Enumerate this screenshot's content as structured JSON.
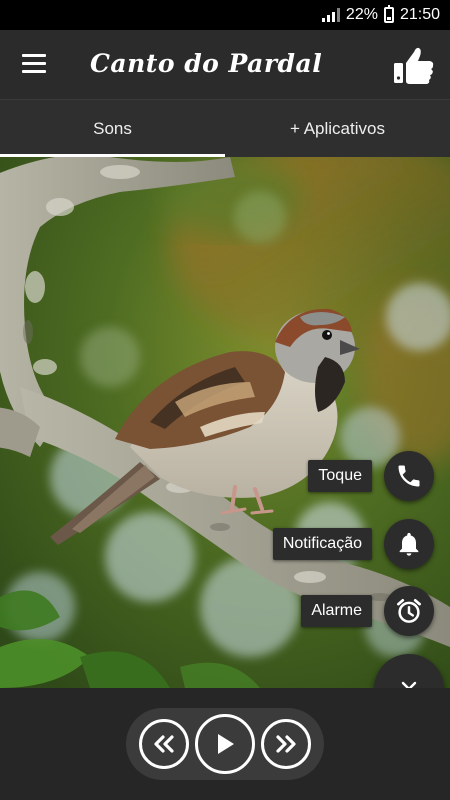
{
  "status_bar": {
    "battery_percent": "22%",
    "time": "21:50"
  },
  "app_bar": {
    "title": "Canto do Pardal"
  },
  "tabs": [
    {
      "label": "Sons",
      "active": true
    },
    {
      "label": "+ Aplicativos",
      "active": false
    }
  ],
  "fab_menu": {
    "items": [
      {
        "label": "Toque",
        "icon": "phone-icon"
      },
      {
        "label": "Notificação",
        "icon": "bell-icon"
      },
      {
        "label": "Alarme",
        "icon": "alarm-clock-icon"
      }
    ],
    "close_icon": "close-icon"
  },
  "player": {
    "controls": [
      "rewind-icon",
      "play-icon",
      "fast-forward-icon"
    ]
  },
  "colors": {
    "app_bar": "#2b2b2b",
    "tabs": "#2f2f2f",
    "fab": "#2c2c2c",
    "player_bar": "#262626",
    "accent": "#ffffff"
  }
}
